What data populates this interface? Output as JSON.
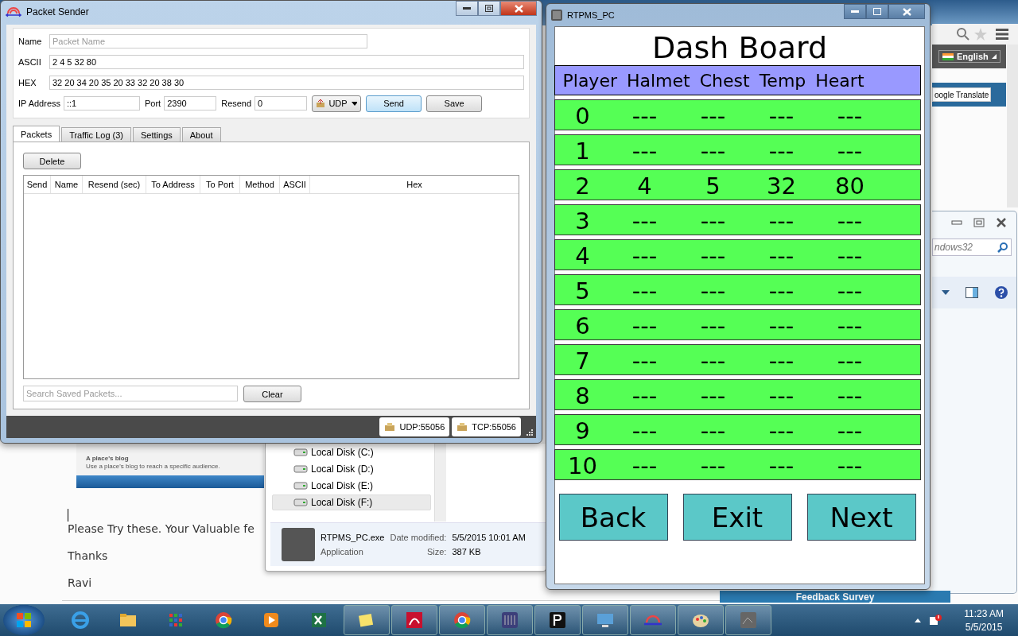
{
  "packet_sender": {
    "title": "Packet Sender",
    "fields": [
      {
        "label": "Name",
        "placeholder": "Packet Name"
      },
      {
        "label": "ASCII",
        "value": "2 4 5 32 80"
      },
      {
        "label": "HEX",
        "value": "32 20 34 20 35 20 33 32 20 38 30"
      }
    ],
    "ip": {
      "label": "IP Address",
      "value": "::1"
    },
    "port": {
      "label": "Port",
      "value": "2390"
    },
    "resend": {
      "label": "Resend",
      "value": "0"
    },
    "method": "UDP",
    "send": "Send",
    "save": "Save",
    "tabs": [
      {
        "label": "Packets",
        "selected": true
      },
      {
        "label": "Traffic Log (3)",
        "selected": false
      },
      {
        "label": "Settings",
        "selected": false
      },
      {
        "label": "About",
        "selected": false
      }
    ],
    "delete": "Delete",
    "columns": [
      "Send",
      "Name",
      "Resend (sec)",
      "To Address",
      "To Port",
      "Method",
      "ASCII",
      "Hex"
    ],
    "search": {
      "placeholder": "Search Saved Packets..."
    },
    "clear": "Clear",
    "status": [
      "UDP:55056",
      "TCP:55056"
    ]
  },
  "dashboard": {
    "title": "RTPMS_PC",
    "heading": "Dash Board",
    "columns": [
      "Player",
      "Halmet",
      "Chest",
      "Temp",
      "Heart"
    ],
    "rows": [
      [
        "0",
        "---",
        "---",
        "---",
        "---"
      ],
      [
        "1",
        "---",
        "---",
        "---",
        "---"
      ],
      [
        "2",
        "4",
        "5",
        "32",
        "80"
      ],
      [
        "3",
        "---",
        "---",
        "---",
        "---"
      ],
      [
        "4",
        "---",
        "---",
        "---",
        "---"
      ],
      [
        "5",
        "---",
        "---",
        "---",
        "---"
      ],
      [
        "6",
        "---",
        "---",
        "---",
        "---"
      ],
      [
        "7",
        "---",
        "---",
        "---",
        "---"
      ],
      [
        "8",
        "---",
        "---",
        "---",
        "---"
      ],
      [
        "9",
        "---",
        "---",
        "---",
        "---"
      ],
      [
        "10",
        "---",
        "---",
        "---",
        "---"
      ]
    ],
    "buttons": [
      "Back",
      "Exit",
      "Next"
    ]
  },
  "background": {
    "language": "English",
    "translate": "oogle Translate",
    "window_search": {
      "placeholder": "ndows32"
    },
    "blog_title": "A place's blog",
    "blog_text": "Use a place's blog to reach a specific audience.",
    "drives": [
      {
        "label": "Local Disk (C:)",
        "selected": false
      },
      {
        "label": "Local Disk (D:)",
        "selected": false
      },
      {
        "label": "Local Disk (E:)",
        "selected": false
      },
      {
        "label": "Local Disk (F:)",
        "selected": true
      }
    ],
    "file": {
      "name": "RTPMS_PC.exe",
      "type": "Application",
      "date_label": "Date modified:",
      "date": "5/5/2015 10:01 AM",
      "size_label": "Size:",
      "size": "387 KB"
    },
    "email_lines": [
      "Please Try these. Your Valuable fe",
      "Thanks",
      "Ravi"
    ],
    "feedback": "Feedback Survey"
  },
  "taskbar": {
    "time": "11:23 AM",
    "date": "5/5/2015"
  }
}
